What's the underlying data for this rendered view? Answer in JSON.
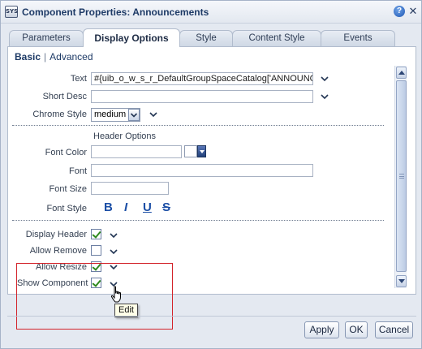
{
  "window": {
    "icon_text": "SYS",
    "title": "Component Properties: Announcements",
    "help_glyph": "?",
    "close_glyph": "✕"
  },
  "tabs": [
    {
      "label": "Parameters",
      "active": false
    },
    {
      "label": "Display Options",
      "active": true
    },
    {
      "label": "Style",
      "active": false
    },
    {
      "label": "Content Style",
      "active": false
    },
    {
      "label": "Events",
      "active": false
    }
  ],
  "subnav": {
    "basic": "Basic",
    "separator": "|",
    "advanced": "Advanced"
  },
  "fields": {
    "text": {
      "label": "Text",
      "value": "#{uib_o_w_s_r_DefaultGroupSpaceCatalog['ANNOUNC"
    },
    "short_desc": {
      "label": "Short Desc",
      "value": ""
    },
    "chrome_style": {
      "label": "Chrome Style",
      "value": "medium"
    }
  },
  "header_options": {
    "title": "Header Options",
    "font_color": {
      "label": "Font Color",
      "value": ""
    },
    "font": {
      "label": "Font",
      "value": ""
    },
    "font_size": {
      "label": "Font Size",
      "value": ""
    },
    "font_style": {
      "label": "Font Style",
      "bold": "B",
      "italic": "I",
      "underline": "U",
      "strike": "S"
    }
  },
  "checkboxes": [
    {
      "label": "Display Header",
      "checked": true
    },
    {
      "label": "Allow Remove",
      "checked": false
    },
    {
      "label": "Allow Resize",
      "checked": true
    },
    {
      "label": "Show Component",
      "checked": true
    }
  ],
  "tooltip": {
    "text": "Edit"
  },
  "footer": {
    "apply": "Apply",
    "ok": "OK",
    "cancel": "Cancel"
  },
  "icons": {
    "chevron": "chevron-down-icon",
    "help": "help-icon",
    "close": "close-icon"
  },
  "colors": {
    "accent": "#1c4fa6",
    "highlight": "#d3232a",
    "check": "#2f8a1e"
  }
}
